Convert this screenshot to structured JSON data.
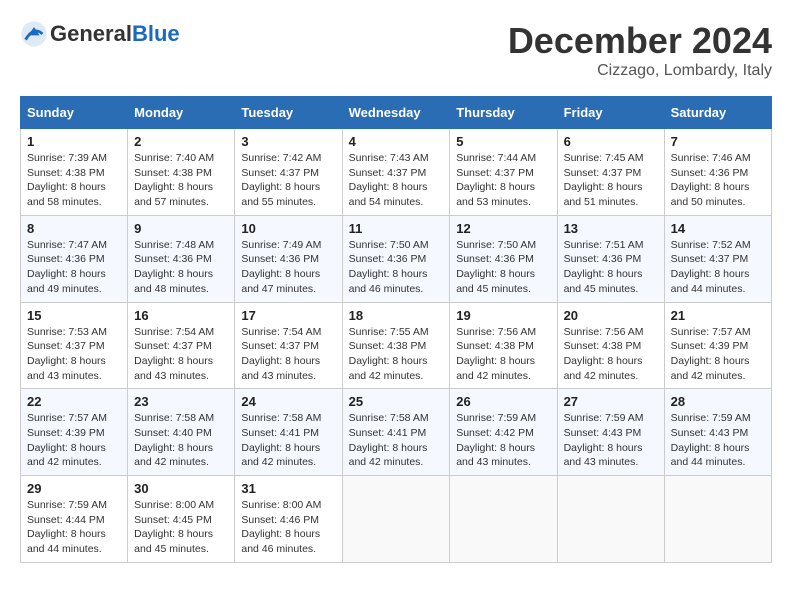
{
  "header": {
    "logo_general": "General",
    "logo_blue": "Blue",
    "month_title": "December 2024",
    "location": "Cizzago, Lombardy, Italy"
  },
  "weekdays": [
    "Sunday",
    "Monday",
    "Tuesday",
    "Wednesday",
    "Thursday",
    "Friday",
    "Saturday"
  ],
  "weeks": [
    [
      {
        "day": "1",
        "sunrise": "7:39 AM",
        "sunset": "4:38 PM",
        "daylight": "8 hours and 58 minutes."
      },
      {
        "day": "2",
        "sunrise": "7:40 AM",
        "sunset": "4:38 PM",
        "daylight": "8 hours and 57 minutes."
      },
      {
        "day": "3",
        "sunrise": "7:42 AM",
        "sunset": "4:37 PM",
        "daylight": "8 hours and 55 minutes."
      },
      {
        "day": "4",
        "sunrise": "7:43 AM",
        "sunset": "4:37 PM",
        "daylight": "8 hours and 54 minutes."
      },
      {
        "day": "5",
        "sunrise": "7:44 AM",
        "sunset": "4:37 PM",
        "daylight": "8 hours and 53 minutes."
      },
      {
        "day": "6",
        "sunrise": "7:45 AM",
        "sunset": "4:37 PM",
        "daylight": "8 hours and 51 minutes."
      },
      {
        "day": "7",
        "sunrise": "7:46 AM",
        "sunset": "4:36 PM",
        "daylight": "8 hours and 50 minutes."
      }
    ],
    [
      {
        "day": "8",
        "sunrise": "7:47 AM",
        "sunset": "4:36 PM",
        "daylight": "8 hours and 49 minutes."
      },
      {
        "day": "9",
        "sunrise": "7:48 AM",
        "sunset": "4:36 PM",
        "daylight": "8 hours and 48 minutes."
      },
      {
        "day": "10",
        "sunrise": "7:49 AM",
        "sunset": "4:36 PM",
        "daylight": "8 hours and 47 minutes."
      },
      {
        "day": "11",
        "sunrise": "7:50 AM",
        "sunset": "4:36 PM",
        "daylight": "8 hours and 46 minutes."
      },
      {
        "day": "12",
        "sunrise": "7:50 AM",
        "sunset": "4:36 PM",
        "daylight": "8 hours and 45 minutes."
      },
      {
        "day": "13",
        "sunrise": "7:51 AM",
        "sunset": "4:36 PM",
        "daylight": "8 hours and 45 minutes."
      },
      {
        "day": "14",
        "sunrise": "7:52 AM",
        "sunset": "4:37 PM",
        "daylight": "8 hours and 44 minutes."
      }
    ],
    [
      {
        "day": "15",
        "sunrise": "7:53 AM",
        "sunset": "4:37 PM",
        "daylight": "8 hours and 43 minutes."
      },
      {
        "day": "16",
        "sunrise": "7:54 AM",
        "sunset": "4:37 PM",
        "daylight": "8 hours and 43 minutes."
      },
      {
        "day": "17",
        "sunrise": "7:54 AM",
        "sunset": "4:37 PM",
        "daylight": "8 hours and 43 minutes."
      },
      {
        "day": "18",
        "sunrise": "7:55 AM",
        "sunset": "4:38 PM",
        "daylight": "8 hours and 42 minutes."
      },
      {
        "day": "19",
        "sunrise": "7:56 AM",
        "sunset": "4:38 PM",
        "daylight": "8 hours and 42 minutes."
      },
      {
        "day": "20",
        "sunrise": "7:56 AM",
        "sunset": "4:38 PM",
        "daylight": "8 hours and 42 minutes."
      },
      {
        "day": "21",
        "sunrise": "7:57 AM",
        "sunset": "4:39 PM",
        "daylight": "8 hours and 42 minutes."
      }
    ],
    [
      {
        "day": "22",
        "sunrise": "7:57 AM",
        "sunset": "4:39 PM",
        "daylight": "8 hours and 42 minutes."
      },
      {
        "day": "23",
        "sunrise": "7:58 AM",
        "sunset": "4:40 PM",
        "daylight": "8 hours and 42 minutes."
      },
      {
        "day": "24",
        "sunrise": "7:58 AM",
        "sunset": "4:41 PM",
        "daylight": "8 hours and 42 minutes."
      },
      {
        "day": "25",
        "sunrise": "7:58 AM",
        "sunset": "4:41 PM",
        "daylight": "8 hours and 42 minutes."
      },
      {
        "day": "26",
        "sunrise": "7:59 AM",
        "sunset": "4:42 PM",
        "daylight": "8 hours and 43 minutes."
      },
      {
        "day": "27",
        "sunrise": "7:59 AM",
        "sunset": "4:43 PM",
        "daylight": "8 hours and 43 minutes."
      },
      {
        "day": "28",
        "sunrise": "7:59 AM",
        "sunset": "4:43 PM",
        "daylight": "8 hours and 44 minutes."
      }
    ],
    [
      {
        "day": "29",
        "sunrise": "7:59 AM",
        "sunset": "4:44 PM",
        "daylight": "8 hours and 44 minutes."
      },
      {
        "day": "30",
        "sunrise": "8:00 AM",
        "sunset": "4:45 PM",
        "daylight": "8 hours and 45 minutes."
      },
      {
        "day": "31",
        "sunrise": "8:00 AM",
        "sunset": "4:46 PM",
        "daylight": "8 hours and 46 minutes."
      },
      null,
      null,
      null,
      null
    ]
  ],
  "labels": {
    "sunrise": "Sunrise:",
    "sunset": "Sunset:",
    "daylight": "Daylight:"
  }
}
